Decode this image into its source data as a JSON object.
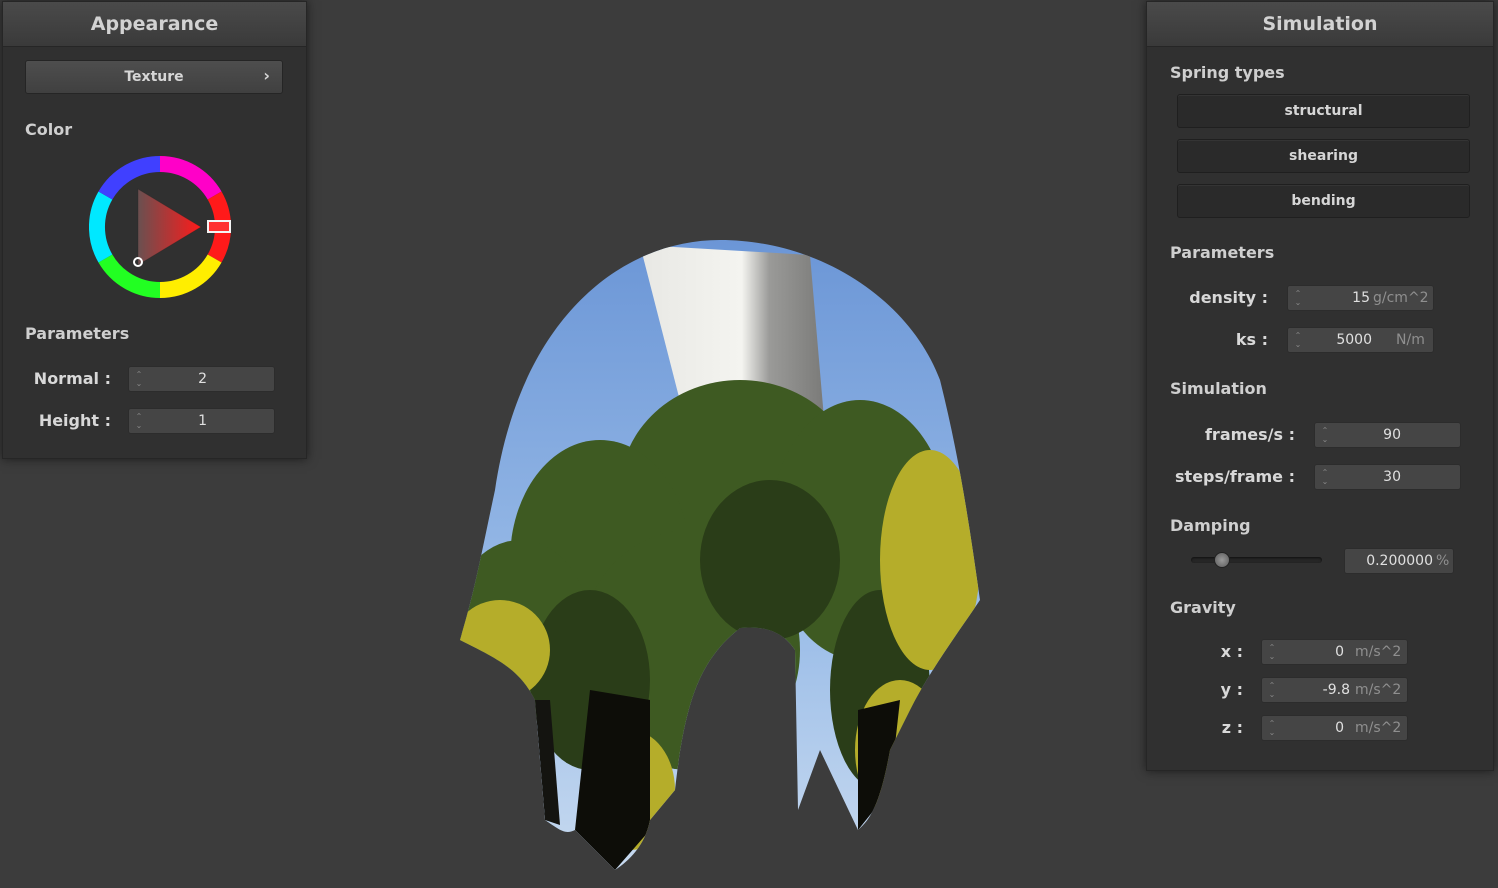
{
  "appearance": {
    "title": "Appearance",
    "texture_button": "Texture",
    "texture_chevron": "›",
    "color_label": "Color",
    "color_value": "#ff0000",
    "parameters_label": "Parameters",
    "normal_label": "Normal :",
    "normal_value": "2",
    "height_label": "Height :",
    "height_value": "1"
  },
  "simulation": {
    "title": "Simulation",
    "spring_types_label": "Spring types",
    "spring_buttons": [
      "structural",
      "shearing",
      "bending"
    ],
    "parameters_label": "Parameters",
    "density_label": "density :",
    "density_value": "15",
    "density_unit": "g/cm^2",
    "ks_label": "ks :",
    "ks_value": "5000",
    "ks_unit": "N/m",
    "simulation_label": "Simulation",
    "fps_label": "frames/s :",
    "fps_value": "90",
    "steps_label": "steps/frame :",
    "steps_value": "30",
    "damping_label": "Damping",
    "damping_value": "0.200000",
    "damping_unit": "%",
    "damping_fraction": 0.2,
    "gravity_label": "Gravity",
    "gx_label": "x :",
    "gx_value": "0",
    "gy_label": "y :",
    "gy_value": "-9.8",
    "gz_label": "z :",
    "gz_value": "0",
    "gravity_unit": "m/s^2"
  },
  "icons": {
    "spin": "spin-arrows-icon",
    "chevron": "chevron-right-icon",
    "color_wheel": "color-wheel-icon"
  }
}
